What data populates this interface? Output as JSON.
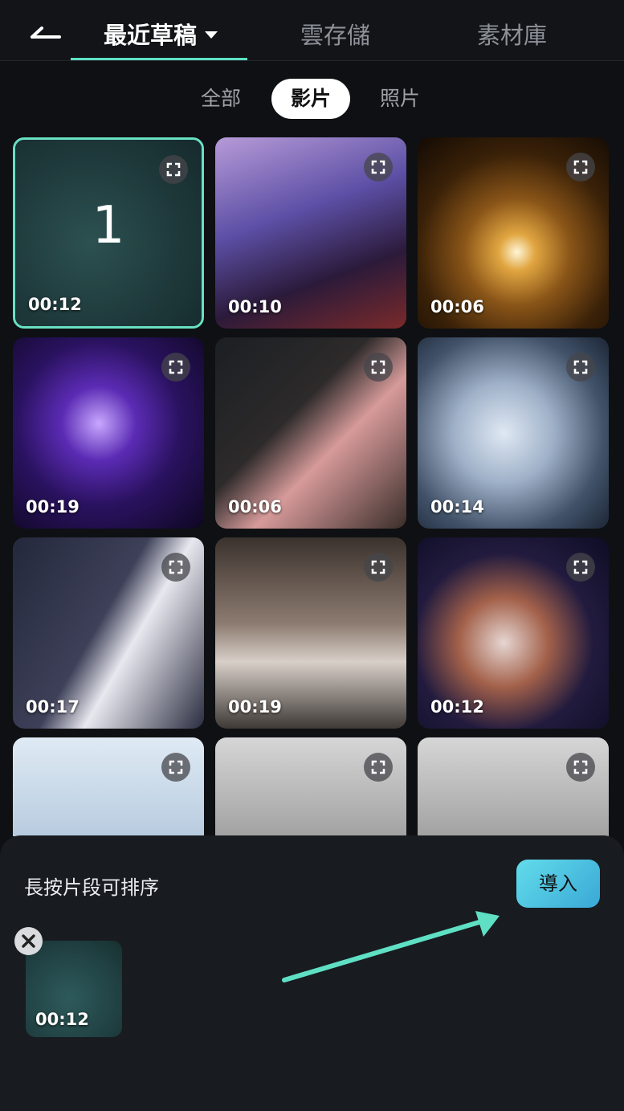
{
  "header": {
    "back_icon": "back-arrow-icon",
    "tabs": [
      {
        "label": "最近草稿",
        "active": true
      },
      {
        "label": "雲存儲",
        "active": false
      },
      {
        "label": "素材庫",
        "active": false
      }
    ]
  },
  "filters": [
    {
      "label": "全部",
      "active": false
    },
    {
      "label": "影片",
      "active": true
    },
    {
      "label": "照片",
      "active": false
    }
  ],
  "grid": {
    "items": [
      {
        "duration": "00:12",
        "selected": true,
        "selection_number": "1"
      },
      {
        "duration": "00:10",
        "selected": false
      },
      {
        "duration": "00:06",
        "selected": false
      },
      {
        "duration": "00:19",
        "selected": false
      },
      {
        "duration": "00:06",
        "selected": false
      },
      {
        "duration": "00:14",
        "selected": false
      },
      {
        "duration": "00:17",
        "selected": false
      },
      {
        "duration": "00:19",
        "selected": false
      },
      {
        "duration": "00:12",
        "selected": false
      },
      {
        "duration": "",
        "selected": false
      },
      {
        "duration": "",
        "selected": false
      },
      {
        "duration": "",
        "selected": false
      }
    ]
  },
  "sheet": {
    "hint": "長按片段可排序",
    "import_label": "導入",
    "selected": [
      {
        "duration": "00:12"
      }
    ]
  },
  "colors": {
    "accent": "#69e0c3",
    "import_button": "#4fc3e0",
    "background": "#0e1013"
  }
}
